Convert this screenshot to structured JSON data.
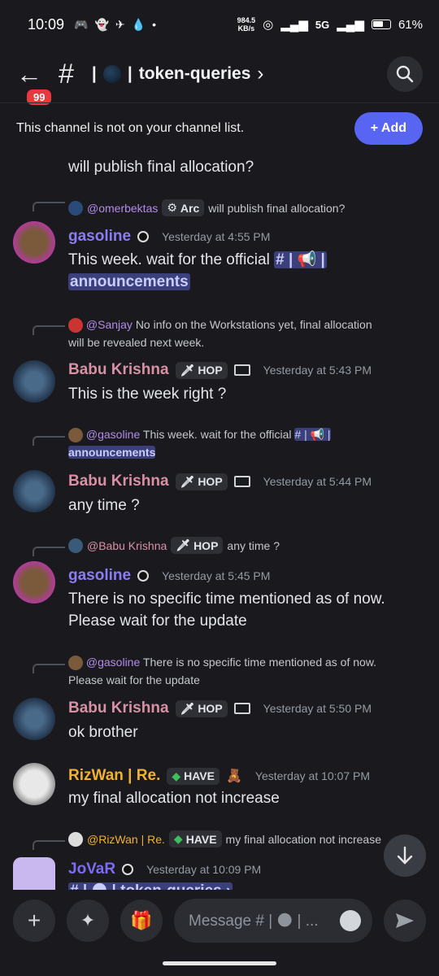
{
  "status_bar": {
    "time": "10:09",
    "net_speed_value": "984.5",
    "net_speed_unit": "KB/s",
    "network": "5G",
    "battery": "61%"
  },
  "header": {
    "unread_count": "99",
    "channel_name": "token-queries",
    "chevron": "›"
  },
  "banner": {
    "text": "This channel is not on your channel list.",
    "add_label": "+ Add"
  },
  "messages": {
    "m0_cont": "will publish final allocation?",
    "m1_reply": {
      "user": "@omerbektas",
      "tag": "Arc",
      "text": "will publish final allocation?"
    },
    "m1": {
      "author": "gasoline",
      "time": "Yesterday at 4:55 PM",
      "line1": "This week. wait for the official",
      "chan_part1": "# | 📢 |",
      "chan_part2": "announcements"
    },
    "m2_reply": {
      "user": "@Sanjay",
      "text1": "No info on the Workstations yet, final allocation",
      "text2": "will be revealed next week."
    },
    "m2": {
      "author": "Babu Krishna",
      "tag": "HOP",
      "time": "Yesterday at 5:43 PM",
      "text": "This is the week right ?"
    },
    "m3_reply": {
      "user": "@gasoline",
      "text": "This week. wait for the official",
      "chan_part1": "# | 📢 |",
      "chan_part2": "announcements"
    },
    "m3": {
      "author": "Babu Krishna",
      "tag": "HOP",
      "time": "Yesterday at 5:44 PM",
      "text": "any time ?"
    },
    "m4_reply": {
      "user": "@Babu Krishna",
      "tag": "HOP",
      "text": "any time ?"
    },
    "m4": {
      "author": "gasoline",
      "time": "Yesterday at 5:45 PM",
      "line1": "There is no specific time mentioned as of now.",
      "line2": "Please wait for the update"
    },
    "m5_reply": {
      "user": "@gasoline",
      "text1": "There is no specific time mentioned as of now.",
      "text2": "Please wait for the update"
    },
    "m5": {
      "author": "Babu Krishna",
      "tag": "HOP",
      "time": "Yesterday at 5:50 PM",
      "text": "ok brother"
    },
    "m6": {
      "author": "RizWan | Re.",
      "tag": "HAVE",
      "time": "Yesterday at 10:07 PM",
      "text": "my final allocation not increase"
    },
    "m7_reply": {
      "user": "@RizWan | Re.",
      "tag": "HAVE",
      "text": "my final allocation not increase"
    },
    "m7": {
      "author": "JoVaR",
      "time": "Yesterday at 10:09 PM",
      "text": "# | 🌑 | token-queries ›"
    }
  },
  "composer": {
    "placeholder": "Message # | 🌑 | ..."
  },
  "colors": {
    "accent": "#5865f2",
    "gasoline": "#8b7cf6",
    "babu": "#d98fa6",
    "rizwan": "#f0b132",
    "jovar": "#7c6cf0"
  }
}
